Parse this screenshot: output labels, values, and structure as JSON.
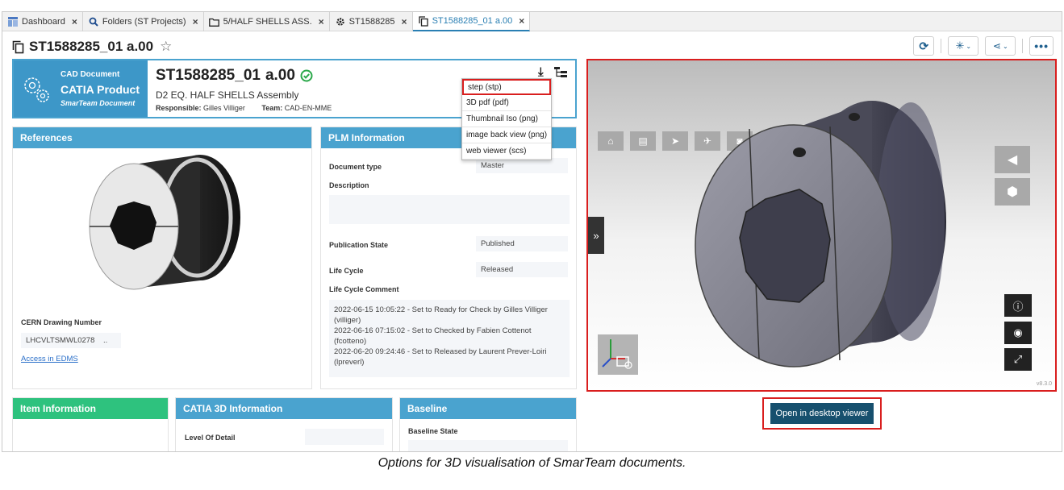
{
  "tabs": [
    {
      "label": "Dashboard",
      "icon": "dashboard-icon"
    },
    {
      "label": "Folders (ST Projects)",
      "icon": "search-icon"
    },
    {
      "label": "5/HALF SHELLS ASS.",
      "icon": "folder-icon"
    },
    {
      "label": "ST1588285",
      "icon": "gear-icon"
    },
    {
      "label": "ST1588285_01 a.00",
      "icon": "copy-icon",
      "active": true
    }
  ],
  "page": {
    "title": "ST1588285_01 a.00"
  },
  "doc": {
    "type": "CAD Document",
    "product": "CATIA Product",
    "family": "SmarTeam Document",
    "title": "ST1588285_01",
    "rev": "a.00",
    "subtitle": "D2 EQ. HALF SHELLS Assembly",
    "responsible_label": "Responsible:",
    "responsible": "Gilles Villiger",
    "team_label": "Team:",
    "team": "CAD-EN-MME"
  },
  "download_menu": [
    "step (stp)",
    "3D pdf (pdf)",
    "Thumbnail Iso (png)",
    "image back view (png)",
    "web viewer (scs)"
  ],
  "references": {
    "title": "References",
    "drawing_label": "CERN Drawing Number",
    "drawing_value": "LHCVLTSMWL0278",
    "drawing_more": "..",
    "edms_link": "Access in EDMS"
  },
  "plm": {
    "title": "PLM Information",
    "doc_type_label": "Document type",
    "doc_type": "Master",
    "description_label": "Description",
    "pub_state_label": "Publication State",
    "pub_state": "Published",
    "lifecycle_label": "Life Cycle",
    "lifecycle": "Released",
    "comment_label": "Life Cycle Comment",
    "comments": [
      "2022-06-15 10:05:22 - Set to Ready for Check by Gilles Villiger (villiger)",
      "2022-06-16 07:15:02 - Set to Checked by Fabien Cottenot (fcotteno)",
      "2022-06-20 09:24:46 - Set to Released by Laurent Prever-Loiri (lpreverl)"
    ]
  },
  "item_info": {
    "title": "Item Information"
  },
  "catia_info": {
    "title": "CATIA 3D Information",
    "lod_label": "Level Of Detail"
  },
  "baseline": {
    "title": "Baseline",
    "state_label": "Baseline State"
  },
  "viewer": {
    "version": "v8.3.0"
  },
  "open_button": "Open in desktop viewer",
  "caption": "Options for 3D visualisation of SmarTeam documents.",
  "colors": {
    "accent": "#4aa3cf",
    "green": "#2ec27e",
    "highlight": "#d91e1e",
    "button": "#17506e"
  }
}
